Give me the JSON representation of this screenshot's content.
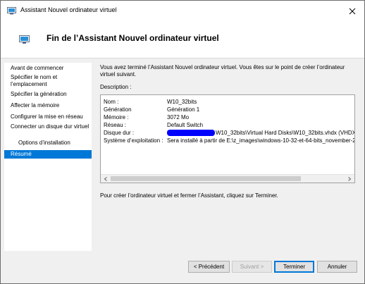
{
  "window": {
    "title": "Assistant Nouvel ordinateur virtuel"
  },
  "header": {
    "title": "Fin de l’Assistant Nouvel ordinateur virtuel"
  },
  "nav": {
    "items": [
      {
        "label": "Avant de commencer"
      },
      {
        "label": "Spécifier le nom et l’emplacement"
      },
      {
        "label": "Spécifier la génération"
      },
      {
        "label": "Affecter la mémoire"
      },
      {
        "label": "Configurer la mise en réseau"
      },
      {
        "label": "Connecter un disque dur virtuel"
      },
      {
        "label": "Options d’installation"
      },
      {
        "label": "Résumé"
      }
    ]
  },
  "main": {
    "intro": "Vous avez terminé l’Assistant Nouvel ordinateur virtuel. Vous êtes sur le point de créer l’ordinateur virtuel suivant.",
    "description_label": "Description :",
    "summary": [
      {
        "key": "Nom :",
        "value": "W10_32bits"
      },
      {
        "key": "Génération",
        "value": "Génération 1"
      },
      {
        "key": "Mémoire :",
        "value": "3072 Mo"
      },
      {
        "key": "Réseau :",
        "value": "Default Switch"
      },
      {
        "key": "Disque dur :",
        "value": "W10_32bits\\Virtual Hard Disks\\W10_32bits.vhdx (VHDX"
      },
      {
        "key": "Système d’exploitation :",
        "value": "Sera installé à partir de E:\\z_images\\windows-10-32-et-64-bits_november-2"
      }
    ],
    "finish_text": "Pour créer l’ordinateur virtuel et fermer l’Assistant, cliquez sur Terminer."
  },
  "buttons": {
    "previous": "< Précédent",
    "next": "Suivant >",
    "finish": "Terminer",
    "cancel": "Annuler"
  },
  "colors": {
    "selection": "#0078d7",
    "redaction": "#0000ff"
  }
}
